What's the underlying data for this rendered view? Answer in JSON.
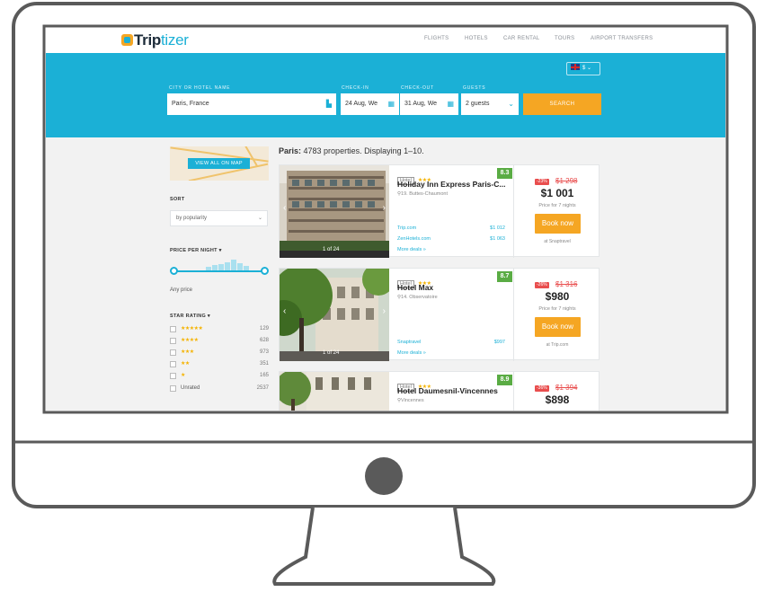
{
  "nav": {
    "logo_main": "Trip",
    "logo_accent": "tizer",
    "links": [
      "FLIGHTS",
      "HOTELS",
      "CAR RENTAL",
      "TOURS",
      "AIRPORT TRANSFERS"
    ]
  },
  "search": {
    "currency_label": "$",
    "city_label": "CITY OR HOTEL NAME",
    "city_value": "Paris, France",
    "checkin_label": "CHECK-IN",
    "checkin_value": "24 Aug, We",
    "checkout_label": "CHECK-OUT",
    "checkout_value": "31 Aug, We",
    "guests_label": "GUESTS",
    "guests_value": "2 guests",
    "search_button": "SEARCH"
  },
  "sidebar": {
    "map_button": "VIEW ALL ON MAP",
    "sort_label": "SORT",
    "sort_value": "by popularity",
    "price_label": "PRICE PER NIGHT",
    "price_value": "Any price",
    "star_label": "STAR RATING",
    "star_filters": [
      {
        "stars": 5,
        "count": "129"
      },
      {
        "stars": 4,
        "count": "628"
      },
      {
        "stars": 3,
        "count": "973"
      },
      {
        "stars": 2,
        "count": "351"
      },
      {
        "stars": 1,
        "count": "165"
      }
    ],
    "unrated_label": "Unrated",
    "unrated_count": "2537"
  },
  "results": {
    "city": "Paris:",
    "summary": "4783 properties. Displaying 1–10.",
    "hotels": [
      {
        "type": "Hotel",
        "stars": 3,
        "rating": "8.3",
        "name": "Holiday Inn Express Paris-C...",
        "location": "19. Buttes-Chaumont",
        "photo_count": "1 of 24",
        "deals": [
          {
            "site": "Trip.com",
            "price": "$1 012"
          },
          {
            "site": "ZenHotels.com",
            "price": "$1 063"
          }
        ],
        "more": "More deals »",
        "discount": "-23%",
        "old_price": "$1 298",
        "price": "$1 001",
        "price_note": "Price for 7 nights",
        "book": "Book now",
        "at": "at Snaptravel"
      },
      {
        "type": "Hotel",
        "stars": 3,
        "rating": "8.7",
        "name": "Hotel Max",
        "location": "14. Observatoire",
        "photo_count": "1 of 24",
        "deals": [
          {
            "site": "Snaptravel",
            "price": "$997"
          }
        ],
        "more": "More deals »",
        "discount": "-26%",
        "old_price": "$1 316",
        "price": "$980",
        "price_note": "Price for 7 nights",
        "book": "Book now",
        "at": "at Trip.com"
      },
      {
        "type": "Hotel",
        "stars": 3,
        "rating": "8.9",
        "name": "Hotel Daumesnil-Vincennes",
        "location": "Vincennes",
        "discount": "-36%",
        "old_price": "$1 394",
        "price": "$898"
      }
    ]
  },
  "colors": {
    "accent": "#1bb0d6",
    "orange": "#f5a623",
    "rating_green": "#5aac44",
    "discount_red": "#e94e4e"
  }
}
